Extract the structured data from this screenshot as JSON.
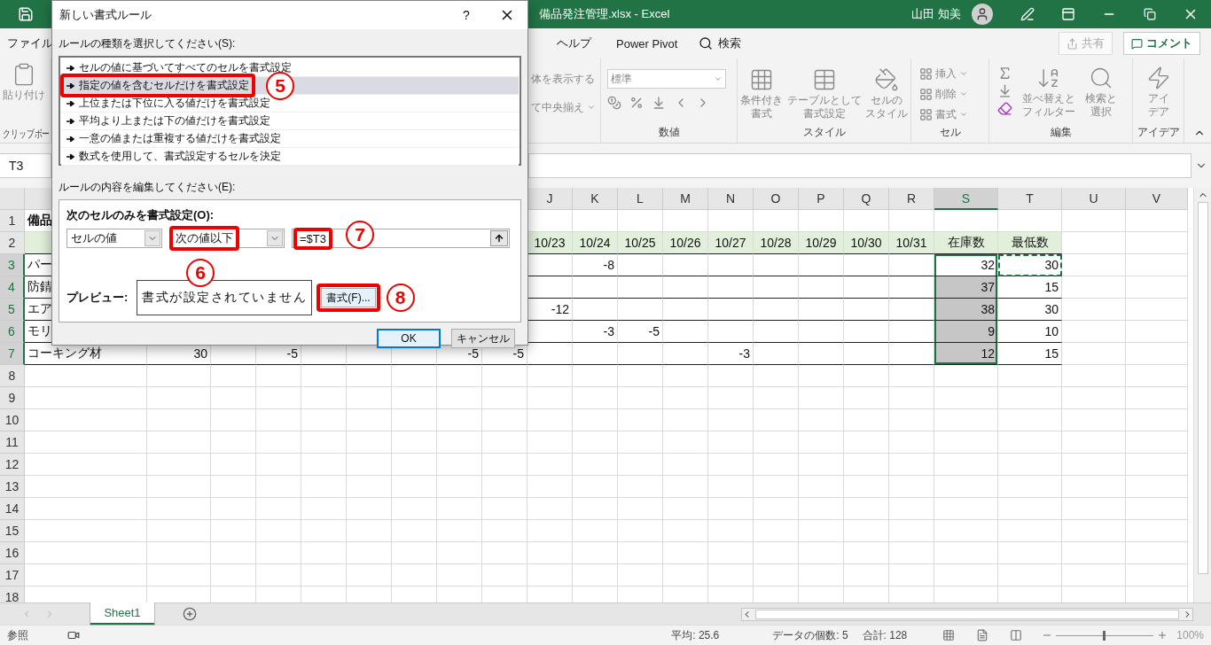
{
  "window": {
    "title": "備品発注管理.xlsx  -  Excel",
    "user": "山田 知美"
  },
  "menu": {
    "left": [
      {
        "label": "ファイル"
      }
    ],
    "right": [
      {
        "label": "ヘルプ"
      },
      {
        "label": "Power Pivot"
      }
    ],
    "search": "検索",
    "share": "共有",
    "comment": "コメント"
  },
  "ribbon": {
    "clipboard": {
      "paste": "貼り付け",
      "label": "クリップボー"
    },
    "alignment": {
      "wrap": "体を表示する",
      "merge": "て中央揃え"
    },
    "number": {
      "format": "標準",
      "label": "数値"
    },
    "styles": {
      "label": "スタイル",
      "buttons": [
        {
          "lines": [
            "条件付き",
            "書式"
          ],
          "kind": "conditional"
        },
        {
          "lines": [
            "テーブルとして",
            "書式設定"
          ],
          "kind": "table"
        },
        {
          "lines": [
            "セルの",
            "スタイル"
          ],
          "kind": "cellstyle"
        }
      ]
    },
    "cells": {
      "label": "セル",
      "buttons": [
        {
          "label": "挿入"
        },
        {
          "label": "削除"
        },
        {
          "label": "書式"
        }
      ]
    },
    "editing": {
      "label": "編集",
      "buttons": [
        {
          "lines": [
            "並べ替えと",
            "フィルター"
          ],
          "kind": "sort"
        },
        {
          "lines": [
            "検索と",
            "選択"
          ],
          "kind": "find"
        }
      ]
    },
    "ideas": {
      "label": "アイデア",
      "lines": [
        "アイ",
        "デア"
      ]
    }
  },
  "name_box": "T3",
  "columns": [
    {
      "letter": "J",
      "selected": false
    },
    {
      "letter": "K",
      "selected": false
    },
    {
      "letter": "L",
      "selected": false
    },
    {
      "letter": "M",
      "selected": false
    },
    {
      "letter": "N",
      "selected": false
    },
    {
      "letter": "O",
      "selected": false
    },
    {
      "letter": "P",
      "selected": false
    },
    {
      "letter": "Q",
      "selected": false
    },
    {
      "letter": "R",
      "selected": false
    },
    {
      "letter": "S",
      "selected": true
    },
    {
      "letter": "T",
      "selected": false
    },
    {
      "letter": "U",
      "selected": false
    },
    {
      "letter": "V",
      "selected": false
    }
  ],
  "rows": [
    {
      "number": "1",
      "kind": "title",
      "selected": false,
      "cells": [
        "備品"
      ]
    },
    {
      "number": "2",
      "kind": "header",
      "selected": false,
      "cells": [
        null,
        null,
        null,
        null,
        null,
        null,
        null,
        null,
        null,
        "10/23",
        "10/24",
        "10/25",
        "10/26",
        "10/27",
        "10/28",
        "10/29",
        "10/30",
        "10/31",
        "在庫数",
        "最低数"
      ]
    },
    {
      "number": "3",
      "kind": "data",
      "selected": true,
      "cells": [
        {
          "text": "パー",
          "selected": false,
          "active": false,
          "copied": false
        },
        null,
        null,
        null,
        null,
        null,
        null,
        null,
        null,
        null,
        {
          "text": "-8",
          "selected": false,
          "active": false,
          "copied": false
        },
        null,
        null,
        null,
        null,
        null,
        null,
        null,
        {
          "text": "32",
          "selected": true,
          "active": true,
          "copied": false
        },
        {
          "text": "30",
          "selected": false,
          "active": false,
          "copied": true
        }
      ]
    },
    {
      "number": "4",
      "kind": "data",
      "selected": true,
      "cells": [
        {
          "text": "防錆",
          "selected": false,
          "active": false,
          "copied": false
        },
        null,
        null,
        null,
        null,
        null,
        null,
        null,
        null,
        null,
        null,
        null,
        null,
        null,
        null,
        null,
        null,
        null,
        {
          "text": "37",
          "selected": true,
          "active": false,
          "copied": false
        },
        {
          "text": "15",
          "selected": false,
          "active": false,
          "copied": false
        }
      ]
    },
    {
      "number": "5",
      "kind": "data",
      "selected": true,
      "cells": [
        {
          "text": "エア",
          "selected": false,
          "active": false,
          "copied": false
        },
        null,
        null,
        null,
        null,
        null,
        null,
        null,
        null,
        {
          "text": "-12",
          "selected": false,
          "active": false,
          "copied": false
        },
        null,
        null,
        null,
        null,
        null,
        null,
        null,
        null,
        {
          "text": "38",
          "selected": true,
          "active": false,
          "copied": false
        },
        {
          "text": "30",
          "selected": false,
          "active": false,
          "copied": false
        }
      ]
    },
    {
      "number": "6",
      "kind": "data",
      "selected": true,
      "cells": [
        {
          "text": "モリ",
          "selected": false,
          "active": false,
          "copied": false
        },
        null,
        null,
        null,
        null,
        null,
        null,
        null,
        null,
        null,
        {
          "text": "-3",
          "selected": false,
          "active": false,
          "copied": false
        },
        {
          "text": "-5",
          "selected": false,
          "active": false,
          "copied": false
        },
        null,
        null,
        null,
        null,
        null,
        null,
        {
          "text": "9",
          "selected": true,
          "active": false,
          "copied": false
        },
        {
          "text": "10",
          "selected": false,
          "active": false,
          "copied": false
        }
      ]
    },
    {
      "number": "7",
      "kind": "data",
      "selected": true,
      "cells": [
        {
          "text": "コーキング材",
          "selected": false,
          "active": false,
          "copied": false
        },
        {
          "text": "30",
          "selected": false,
          "active": false,
          "copied": false
        },
        null,
        {
          "text": "-5",
          "selected": false,
          "active": false,
          "copied": false
        },
        null,
        null,
        null,
        {
          "text": "-5",
          "selected": false,
          "active": false,
          "copied": false
        },
        {
          "text": "-5",
          "selected": false,
          "active": false,
          "copied": false
        },
        null,
        null,
        null,
        null,
        {
          "text": "-3",
          "selected": false,
          "active": false,
          "copied": false
        },
        null,
        null,
        null,
        null,
        {
          "text": "12",
          "selected": true,
          "active": false,
          "copied": false
        },
        {
          "text": "15",
          "selected": false,
          "active": false,
          "copied": false
        }
      ]
    },
    {
      "number": "8",
      "kind": "blank",
      "selected": false
    },
    {
      "number": "9",
      "kind": "blank",
      "selected": false
    },
    {
      "number": "10",
      "kind": "blank",
      "selected": false
    },
    {
      "number": "11",
      "kind": "blank",
      "selected": false
    },
    {
      "number": "12",
      "kind": "blank",
      "selected": false
    },
    {
      "number": "13",
      "kind": "blank",
      "selected": false
    },
    {
      "number": "14",
      "kind": "blank",
      "selected": false
    },
    {
      "number": "15",
      "kind": "blank",
      "selected": false
    },
    {
      "number": "16",
      "kind": "blank",
      "selected": false
    },
    {
      "number": "17",
      "kind": "blank",
      "selected": false
    },
    {
      "number": "18",
      "kind": "blank",
      "selected": false
    }
  ],
  "sheets": [
    {
      "label": "Sheet1",
      "selected": true
    }
  ],
  "status_bar": {
    "mode": "参照",
    "average": "平均: 25.6",
    "count": "データの個数: 5",
    "sum": "合計: 128",
    "zoom": "100%",
    "zoom_slider": {
      "level": 0.5
    }
  },
  "dialog": {
    "title": "新しい書式ルール",
    "help": "?",
    "type_label": "ルールの種類を選択してください(S):",
    "rule_types": [
      {
        "label": "セルの値に基づいてすべてのセルを書式設定",
        "selected": false
      },
      {
        "label": "指定の値を含むセルだけを書式設定",
        "selected": true
      },
      {
        "label": "上位または下位に入る値だけを書式設定",
        "selected": false
      },
      {
        "label": "平均より上または下の値だけを書式設定",
        "selected": false
      },
      {
        "label": "一意の値または重複する値だけを書式設定",
        "selected": false
      },
      {
        "label": "数式を使用して、書式設定するセルを決定",
        "selected": false
      }
    ],
    "edit_label": "ルールの内容を編集してください(E):",
    "condition_title": "次のセルのみを書式設定(O):",
    "field1": "セルの値",
    "operator": "次の値以下",
    "value": "=$T3",
    "preview_label": "プレビュー:",
    "preview_text": "書式が設定されていません",
    "format_button": "書式(F)...",
    "ok": "OK",
    "cancel": "キャンセル"
  },
  "annotations": [
    {
      "number": "5"
    },
    {
      "number": "6"
    },
    {
      "number": "7"
    },
    {
      "number": "8"
    }
  ]
}
